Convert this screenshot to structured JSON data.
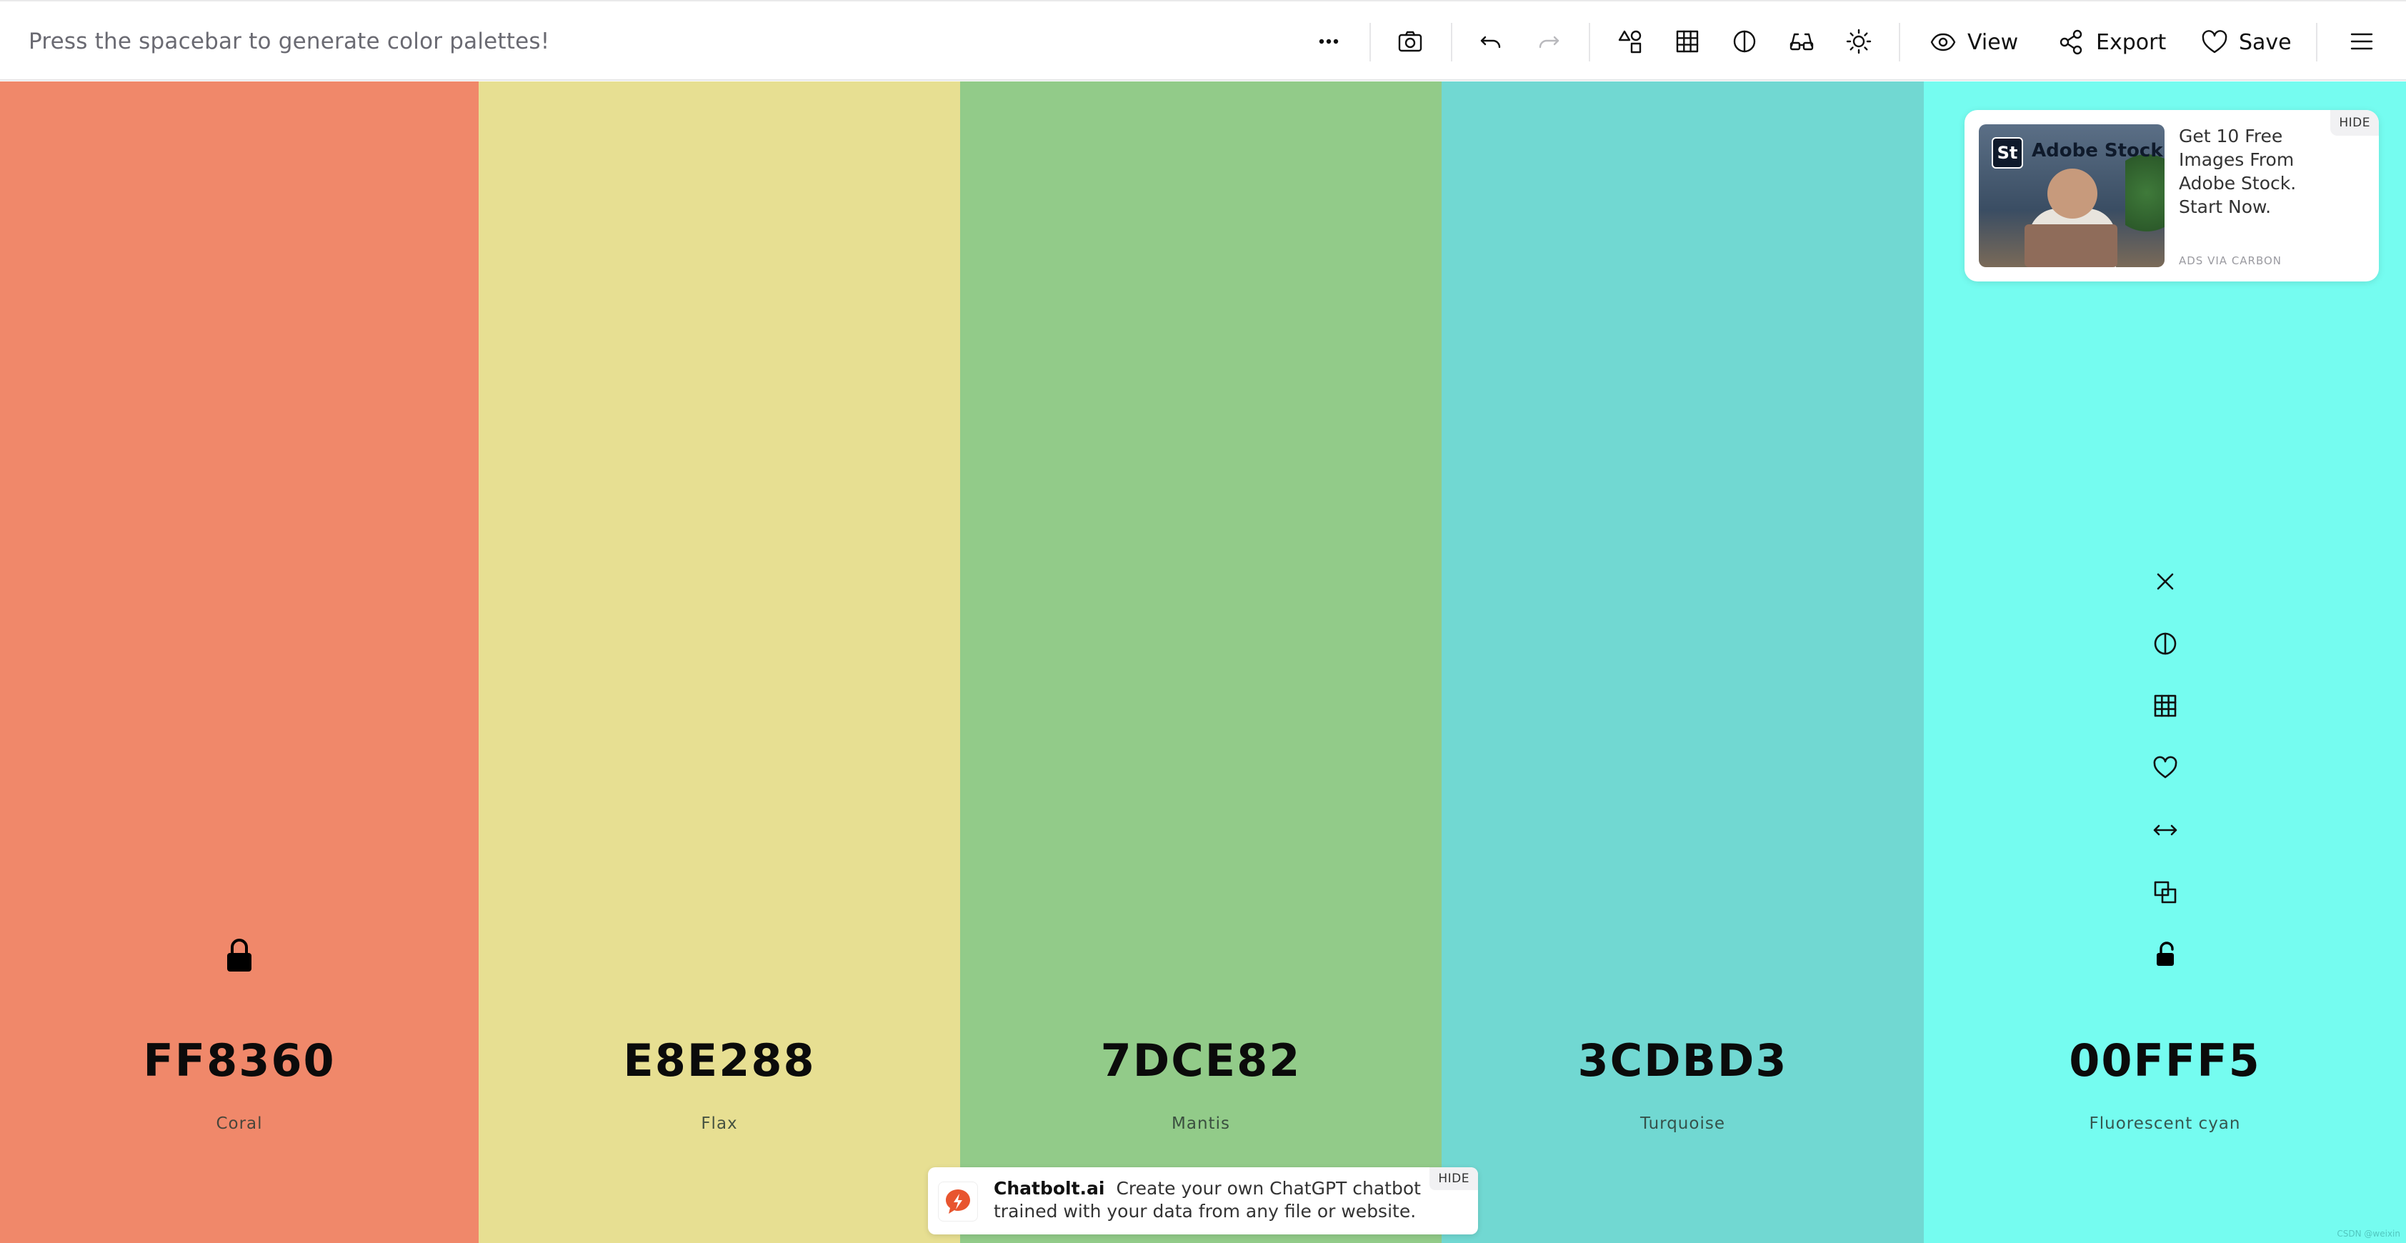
{
  "toolbar": {
    "hint": "Press the spacebar to generate color palettes!",
    "view_label": "View",
    "export_label": "Export",
    "save_label": "Save",
    "icons": [
      "more-icon",
      "camera-icon",
      "undo-icon",
      "redo-icon",
      "shapes-icon",
      "grid-icon",
      "contrast-icon",
      "glasses-icon",
      "sun-icon",
      "eye-icon",
      "share-icon",
      "heart-icon",
      "menu-icon"
    ]
  },
  "palette": {
    "swatches": [
      {
        "hex": "FF8360",
        "name": "Coral",
        "color": "#F0886A",
        "locked": true
      },
      {
        "hex": "E8E288",
        "name": "Flax",
        "color": "#E7DF92",
        "locked": false
      },
      {
        "hex": "7DCE82",
        "name": "Mantis",
        "color": "#92CB89",
        "locked": false
      },
      {
        "hex": "3CDBD3",
        "name": "Turquoise",
        "color": "#71D8D2",
        "locked": false
      },
      {
        "hex": "00FFF5",
        "name": "Fluorescent cyan",
        "color": "#75FCF0",
        "locked": false
      }
    ],
    "hovered_actions": [
      "close-icon",
      "contrast-icon",
      "grid-icon",
      "heart-icon",
      "drag-icon",
      "copy-icon",
      "unlock-icon"
    ]
  },
  "ad": {
    "image_brand": "Adobe Stock",
    "image_badge": "St",
    "text": "Get 10 Free Images From Adobe Stock. Start Now.",
    "sub": "ADS VIA CARBON",
    "hide": "HIDE"
  },
  "banner": {
    "title": "Chatbolt.ai",
    "text": "Create your own ChatGPT chatbot trained with your data from any file or website.",
    "hide": "HIDE"
  },
  "credit": "CSDN @weixin"
}
